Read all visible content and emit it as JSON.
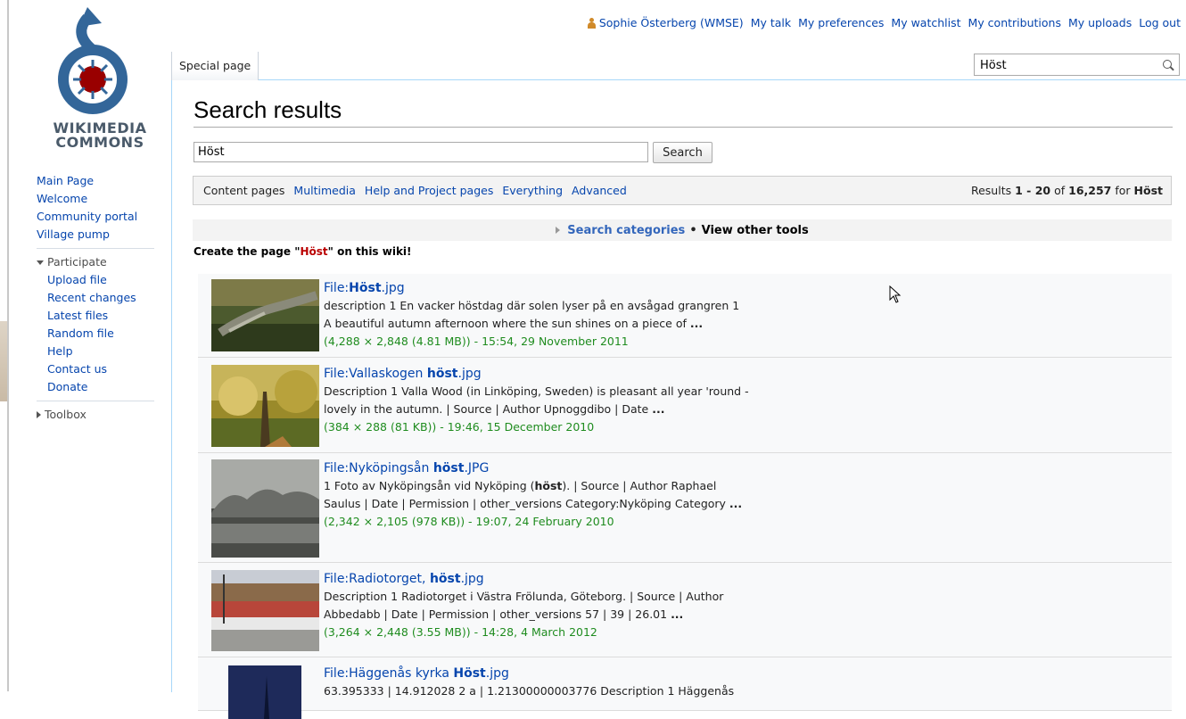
{
  "personal": {
    "username": "Sophie Österberg (WMSE)",
    "links": [
      "My talk",
      "My preferences",
      "My watchlist",
      "My contributions",
      "My uploads",
      "Log out"
    ]
  },
  "logo": {
    "line1": "WIKIMEDIA",
    "line2": "COMMONS"
  },
  "sidebar": {
    "nav": [
      "Main Page",
      "Welcome",
      "Community portal",
      "Village pump"
    ],
    "participate_label": "Participate",
    "participate": [
      "Upload file",
      "Recent changes",
      "Latest files",
      "Random file",
      "Help",
      "Contact us",
      "Donate"
    ],
    "toolbox_label": "Toolbox"
  },
  "tab": {
    "label": "Special page"
  },
  "top_search": {
    "value": "Höst"
  },
  "page_title": "Search results",
  "search": {
    "value": "Höst",
    "button": "Search"
  },
  "profiles": {
    "items": [
      "Content pages",
      "Multimedia",
      "Help and Project pages",
      "Everything",
      "Advanced"
    ],
    "results_prefix": "Results",
    "range": "1 - 20",
    "of": "of",
    "total": "16,257",
    "for": "for",
    "query": "Höst"
  },
  "tools": {
    "search_categories": "Search categories",
    "bullet": "•",
    "other_tools": "View other tools"
  },
  "create": {
    "prefix": "Create the page \"",
    "term": "Höst",
    "suffix": "\" on this wiki!"
  },
  "results": [
    {
      "title_pre": "File:",
      "title_hl": "Höst",
      "title_post": ".jpg",
      "line1": "description 1 En vacker höstdag där solen lyser på en avsågad grangren 1",
      "line2": "A beautiful autumn afternoon where the sun shines on a piece of ",
      "line2_end": "...",
      "meta": "(4,288 × 2,848 (4.81 MB)) - 15:54, 29 November 2011"
    },
    {
      "title_pre": "File:Vallaskogen ",
      "title_hl": "höst",
      "title_post": ".jpg",
      "line1": "Description 1 Valla Wood (in Linköping, Sweden) is pleasant all year 'round -",
      "line2": "lovely in the autumn. | Source | Author Upnoggdibo | Date ",
      "line2_end": "...",
      "meta": "(384 × 288 (81 KB)) - 19:46, 15 December 2010"
    },
    {
      "title_pre": "File:Nyköpingsån ",
      "title_hl": "höst",
      "title_post": ".JPG",
      "line1_pre": "1 Foto av Nyköpingsån vid Nyköping (",
      "line1_hl": "höst",
      "line1_post": "). | Source | Author Raphael",
      "line2": "Saulus | Date | Permission | other_versions Category:Nyköping Category ",
      "line2_end": "...",
      "meta": "(2,342 × 2,105 (978 KB)) - 19:07, 24 February 2010"
    },
    {
      "title_pre": "File:Radiotorget, ",
      "title_hl": "höst",
      "title_post": ".jpg",
      "line1": "Description 1 Radiotorget i Västra Frölunda, Göteborg. | Source | Author",
      "line2": "Abbedabb | Date | Permission | other_versions 57 | 39 | 26.01 ",
      "line2_end": "...",
      "meta": "(3,264 × 2,448 (3.55 MB)) - 14:28, 4 March 2012"
    },
    {
      "title_pre": "File:Häggenås kyrka ",
      "title_hl": "Höst",
      "title_post": ".jpg",
      "line1": "63.395333 | 14.912028 2 a | 1.21300000003776 Description 1 Häggenås"
    }
  ]
}
